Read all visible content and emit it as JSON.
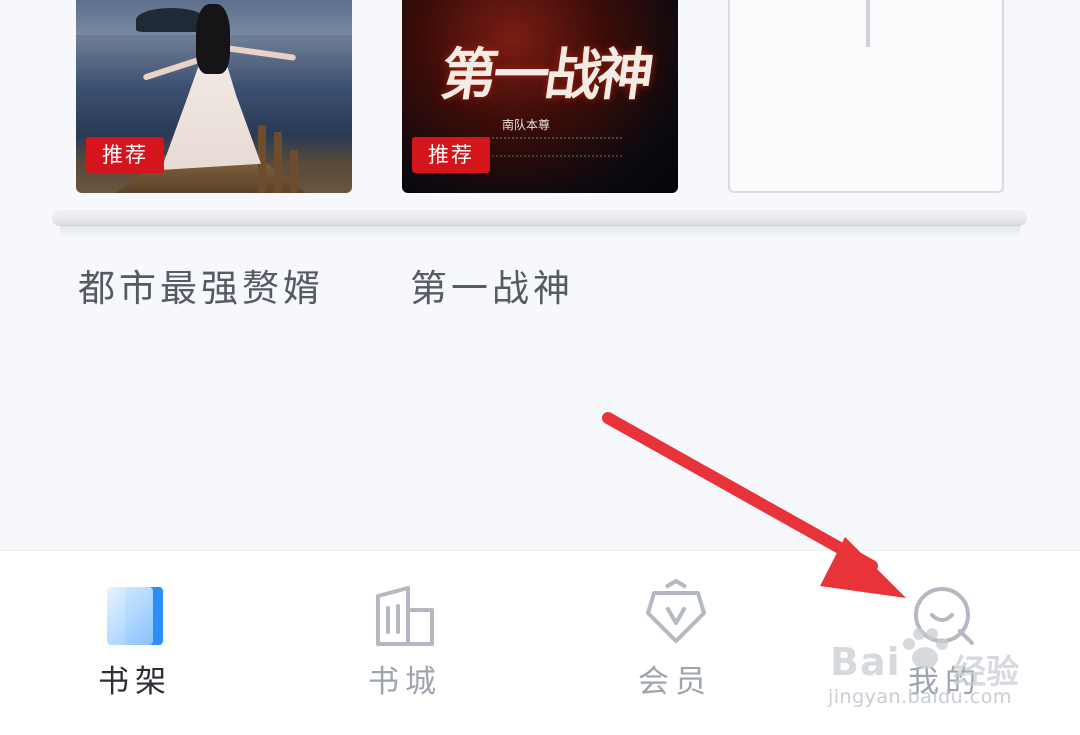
{
  "shelf": {
    "books": [
      {
        "title": "都市最强赘婿",
        "badge": "推荐"
      },
      {
        "title": "第一战神",
        "badge": "推荐",
        "cover_title": "第一战神",
        "cover_author": "南队本尊"
      }
    ]
  },
  "nav": {
    "items": [
      {
        "label": "书架",
        "icon": "bookshelf-icon",
        "active": true
      },
      {
        "label": "书城",
        "icon": "bookstore-building-icon",
        "active": false
      },
      {
        "label": "会员",
        "icon": "vip-crown-icon",
        "active": false
      },
      {
        "label": "我的",
        "icon": "profile-smile-icon",
        "active": false
      }
    ]
  },
  "watermark": {
    "logo": "Bai",
    "logo_cn": "经验",
    "url": "jingyan.baidu.com"
  },
  "colors": {
    "active_tab": "#2f8ef5",
    "badge": "#d4151c",
    "arrow": "#e8333a"
  }
}
